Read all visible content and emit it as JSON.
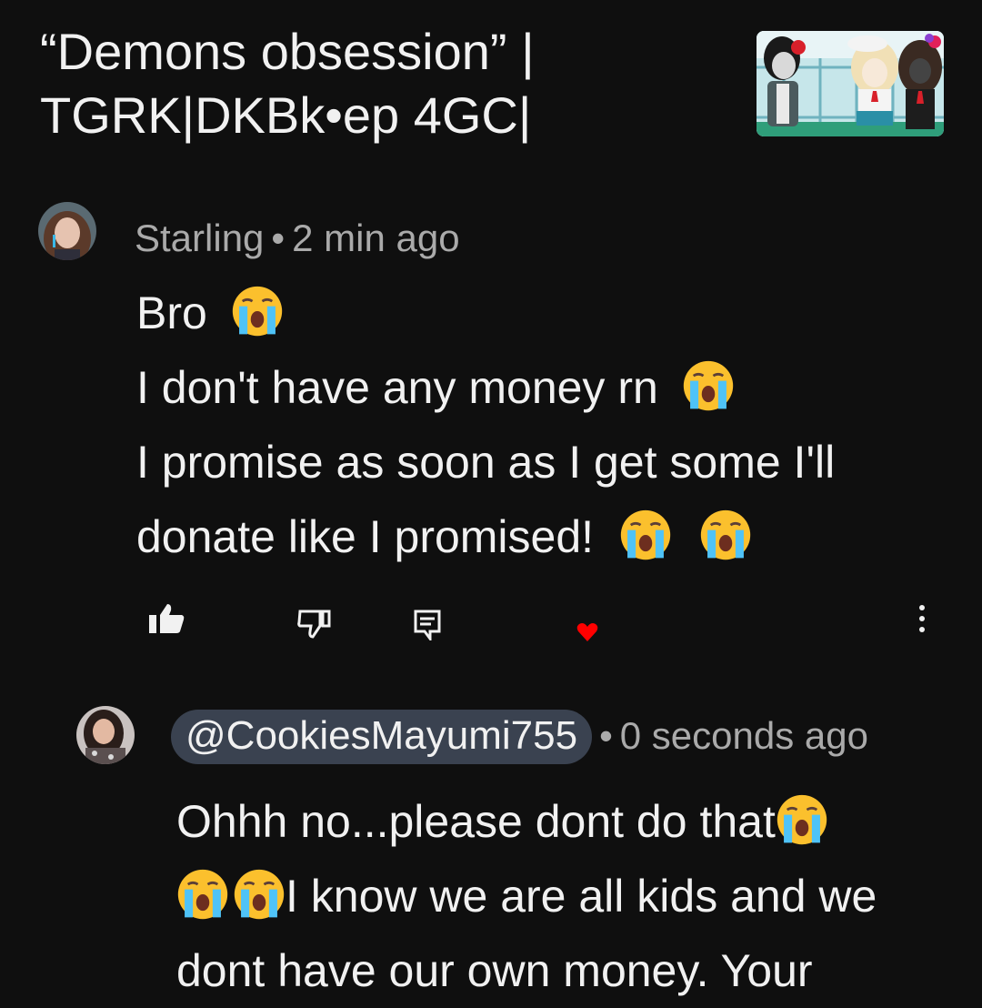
{
  "video": {
    "title_line1": "“Demons obsession” |",
    "title_line2": "TGRK|DKBk•ep 4GC|"
  },
  "comment": {
    "author": "Starling",
    "separator": "•",
    "time": "2 min ago",
    "lines": [
      "Bro",
      "I don't have any money rn",
      "I promise as soon as I get some I'll",
      "donate like I promised!"
    ],
    "actions": {
      "like_icon": "thumbs-up-icon",
      "dislike_icon": "thumbs-down-icon",
      "reply_icon": "reply-icon",
      "heart_icon": "creator-heart-icon",
      "more_icon": "more-vert-icon"
    }
  },
  "reply": {
    "mention": "@CookiesMayumi755",
    "separator": "•",
    "time": "0 seconds ago",
    "line1": "Ohhh no...please dont do that",
    "line2": "I know we are all kids and we",
    "line3": "dont have our own money. Your"
  },
  "colors": {
    "background": "#0f0f0f",
    "text": "#f1f1f1",
    "meta": "#aaaaaa",
    "heart": "#ff0000",
    "mention_bg": "#3a4250"
  }
}
